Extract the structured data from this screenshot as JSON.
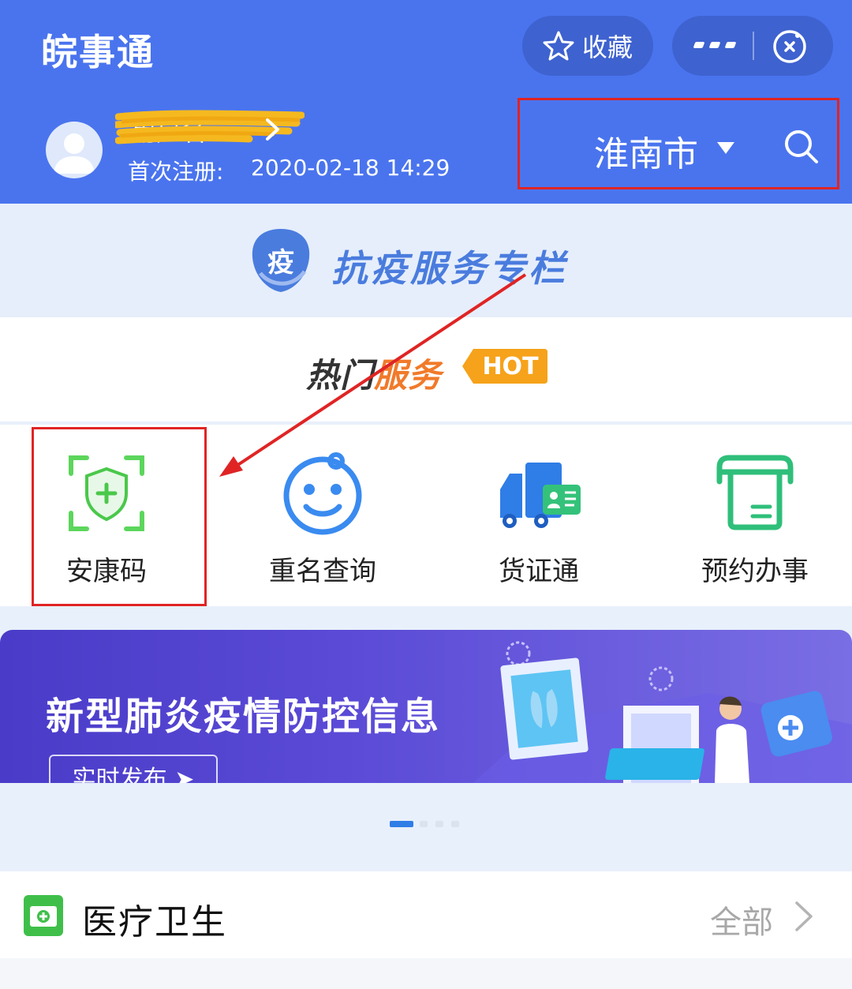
{
  "header": {
    "app_title": "皖事通",
    "favorite_label": "收藏",
    "user": {
      "name": "用户名",
      "registered_label": "首次注册:",
      "registered_value": "2020-02-18 14:29"
    },
    "city": "淮南市"
  },
  "epidemic_column": {
    "badge_char": "疫",
    "title": "抗疫服务专栏"
  },
  "hot_services": {
    "title_dark": "热门",
    "title_orange": "服务",
    "badge": "HOT",
    "items": [
      {
        "label": "安康码",
        "icon": "health-code-shield-icon"
      },
      {
        "label": "重名查询",
        "icon": "baby-face-icon"
      },
      {
        "label": "货证通",
        "icon": "truck-id-card-icon"
      },
      {
        "label": "预约办事",
        "icon": "ticket-machine-icon"
      }
    ]
  },
  "banner": {
    "title": "新型肺炎疫情防控信息",
    "button": "实时发布 ➤",
    "pager": {
      "count": 4,
      "active": 0
    }
  },
  "medical": {
    "title": "医疗卫生",
    "all_link": "全部"
  },
  "colors": {
    "header_blue": "#4a74ee",
    "capsule_blue": "#3e62cf",
    "annotation_red": "#e02424",
    "hot_orange": "#f6a21a",
    "green": "#3fbf4a",
    "brand_blue": "#4a7cde"
  }
}
